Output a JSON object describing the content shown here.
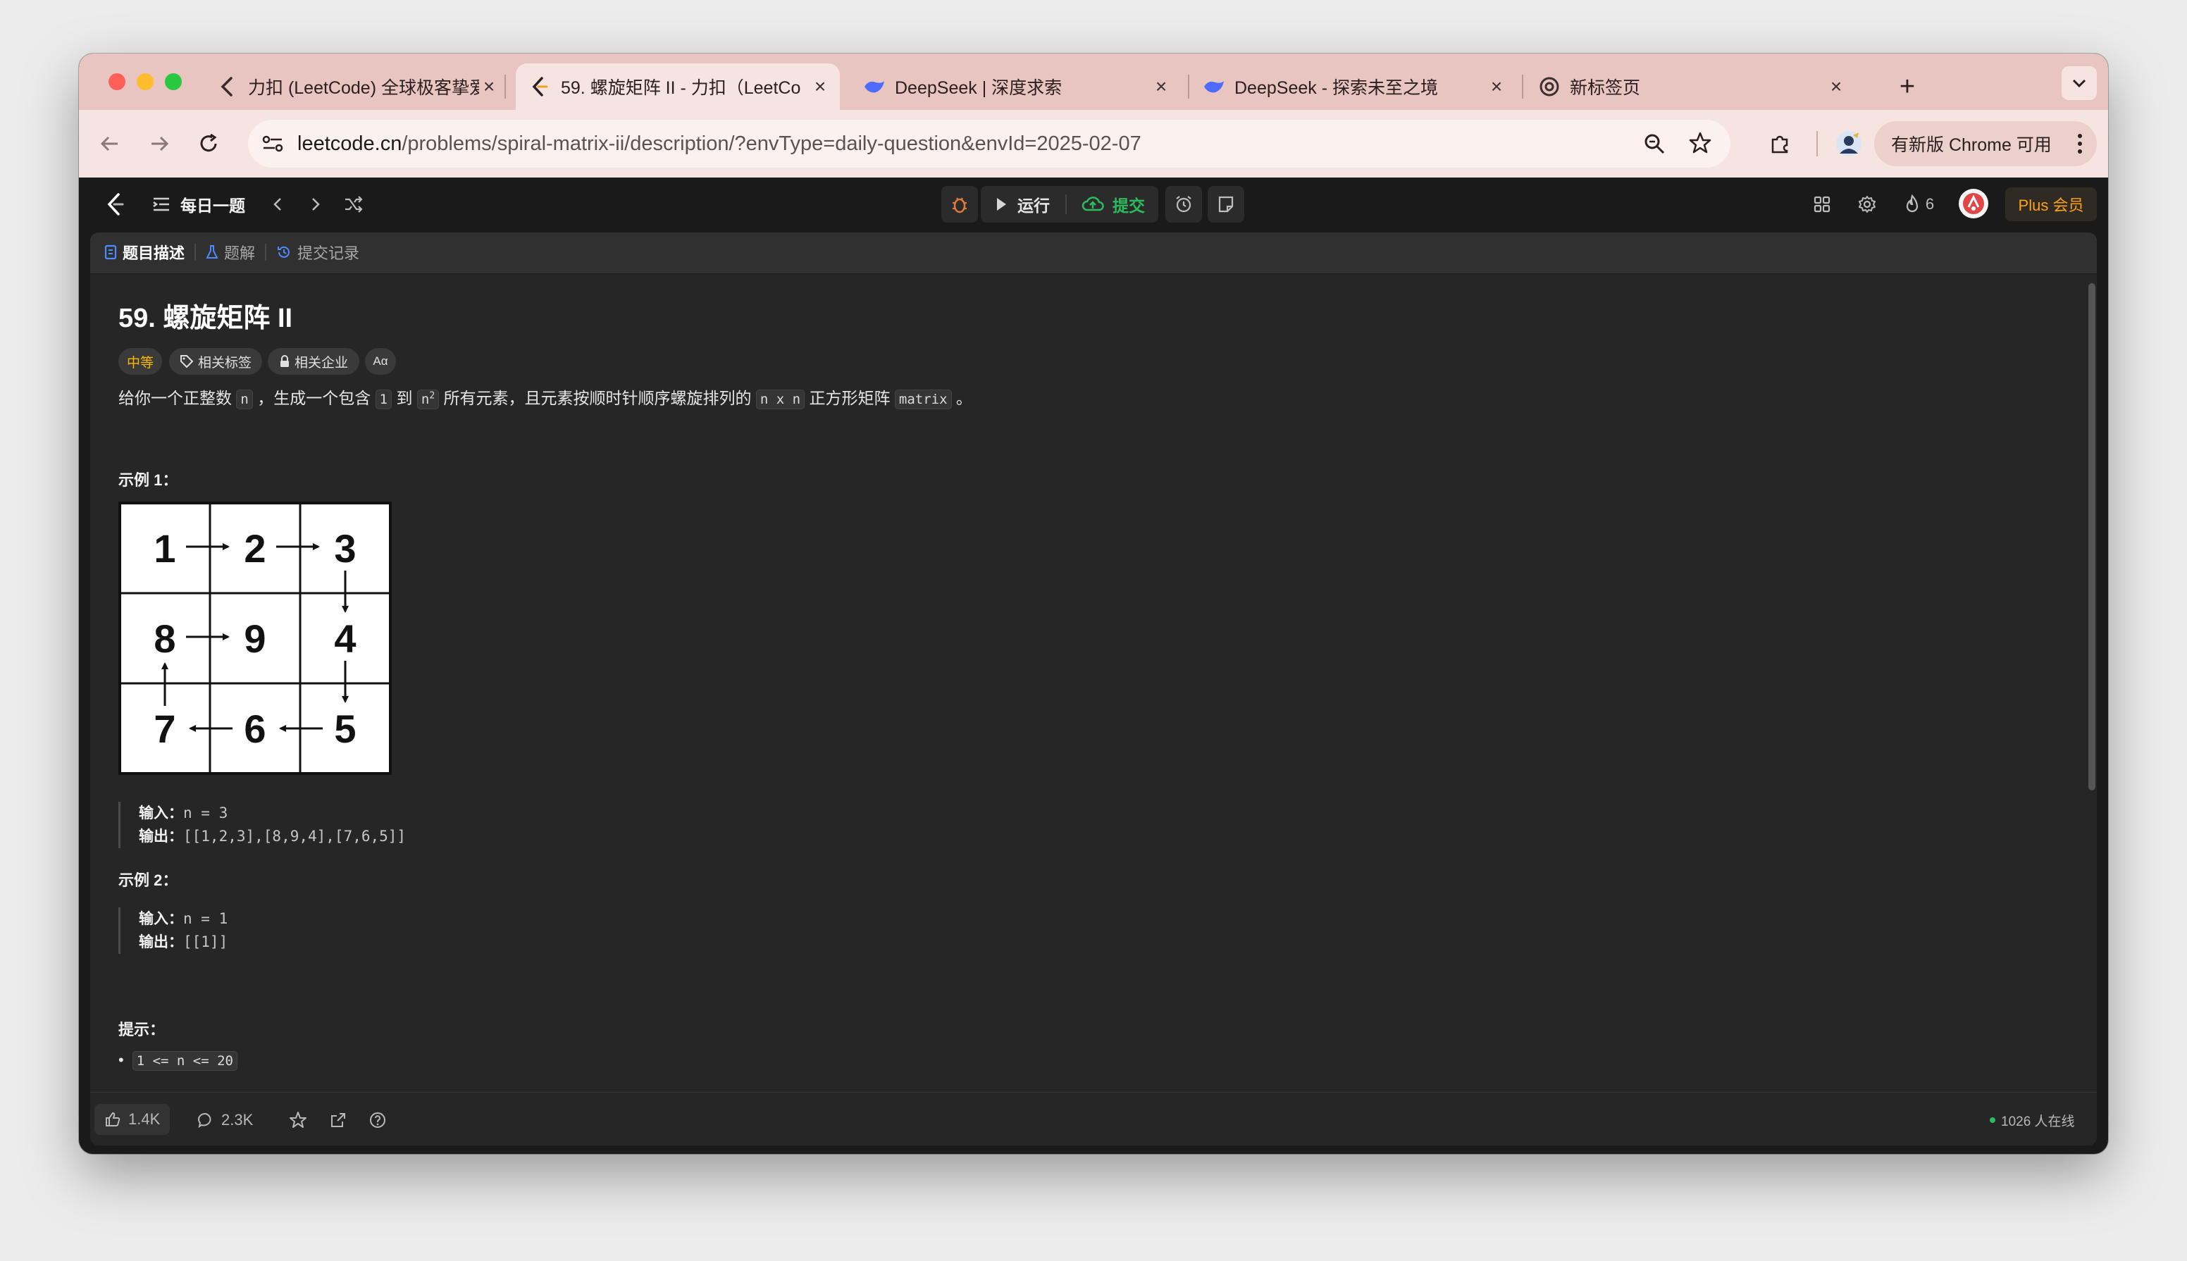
{
  "browser": {
    "tabs": [
      {
        "title": "力扣 (LeetCode) 全球极客挚爱",
        "icon": "leetcode-icon",
        "active": false
      },
      {
        "title": "59. 螺旋矩阵 II - 力扣（LeetCo",
        "icon": "leetcode-icon",
        "active": true
      },
      {
        "title": "DeepSeek | 深度求索",
        "icon": "deepseek-icon",
        "active": false
      },
      {
        "title": "DeepSeek - 探索未至之境",
        "icon": "deepseek-icon",
        "active": false
      },
      {
        "title": "新标签页",
        "icon": "chrome-icon",
        "active": false
      }
    ],
    "new_tab": "+",
    "url_domain": "leetcode.cn",
    "url_path": "/problems/spiral-matrix-ii/description/?envType=daily-question&envId=2025-02-07",
    "update_label": "有新版 Chrome 可用"
  },
  "header": {
    "daily_label": "每日一题",
    "run_label": "运行",
    "submit_label": "提交",
    "streak_count": "6",
    "plus_label": "Plus 会员"
  },
  "panel_tabs": [
    {
      "label": "题目描述",
      "icon": "document-icon"
    },
    {
      "label": "题解",
      "icon": "flask-icon"
    },
    {
      "label": "提交记录",
      "icon": "history-icon"
    }
  ],
  "problem": {
    "title": "59. 螺旋矩阵 II",
    "tags": {
      "difficulty": "中等",
      "related_tags": "相关标签",
      "related_companies": "相关企业",
      "font_toggle": "Aα"
    },
    "description": {
      "p1": "给你一个正整数 ",
      "c1": "n",
      "p2": " ，生成一个包含 ",
      "c2": "1",
      "p3": " 到 ",
      "c3": "n",
      "sup": "2",
      "p4": " 所有元素，且元素按顺时针顺序螺旋排列的 ",
      "c4": "n x n",
      "p5": " 正方形矩阵 ",
      "c5": "matrix",
      "p6": " 。"
    },
    "example1": {
      "heading": "示例 1：",
      "matrix": [
        [
          "1",
          "2",
          "3"
        ],
        [
          "8",
          "9",
          "4"
        ],
        [
          "7",
          "6",
          "5"
        ]
      ],
      "input_label": "输入：",
      "input_value": "n = 3",
      "output_label": "输出：",
      "output_value": "[[1,2,3],[8,9,4],[7,6,5]]"
    },
    "example2": {
      "heading": "示例 2：",
      "input_label": "输入：",
      "input_value": "n = 1",
      "output_label": "输出：",
      "output_value": "[[1]]"
    },
    "hints": {
      "heading": "提示：",
      "constraint": "1 <= n <= 20"
    }
  },
  "footer": {
    "likes": "1.4K",
    "comments": "2.3K",
    "online": "1026 人在线"
  },
  "colors": {
    "tabstrip": "#e8c5c1",
    "toolbar": "#f6e4e1",
    "background": "#1a1a1a",
    "panel": "#262626",
    "submit_green": "#2cbb5d",
    "difficulty_yellow": "#ffb800",
    "plus_gold": "#ffa116"
  }
}
